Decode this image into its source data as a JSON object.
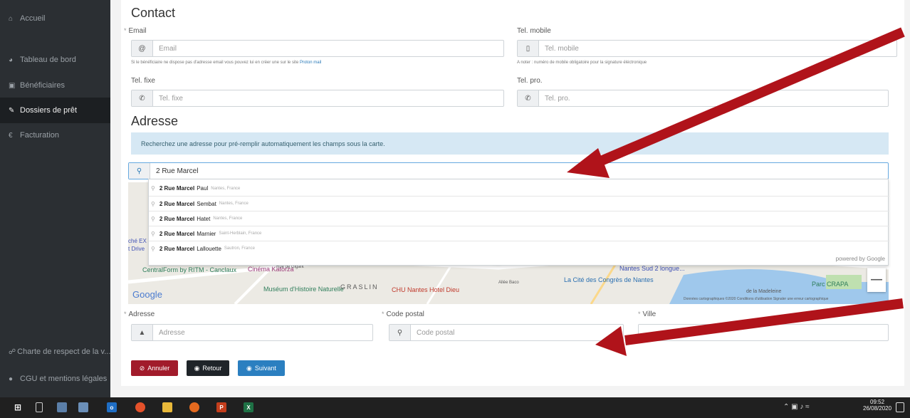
{
  "sidebar": {
    "items": [
      {
        "icon": "home-icon",
        "glyph": "⌂",
        "label": "Accueil"
      },
      {
        "icon": "dashboard-icon",
        "glyph": "◕",
        "label": "Tableau de bord"
      },
      {
        "icon": "beneficiaries-icon",
        "glyph": "▣",
        "label": "Bénéficiaires"
      },
      {
        "icon": "loan-files-icon",
        "glyph": "✎",
        "label": "Dossiers de prêt"
      },
      {
        "icon": "euro-icon",
        "glyph": "€",
        "label": "Facturation"
      },
      {
        "icon": "charter-icon",
        "glyph": "☍",
        "label": "Charte de respect de la v..."
      },
      {
        "icon": "info-icon",
        "glyph": "●",
        "label": "CGU et mentions légales"
      }
    ]
  },
  "contact": {
    "title": "Contact",
    "email": {
      "label": "Email",
      "placeholder": "Email",
      "icon_glyph": "@",
      "help": "Si le bénéficiaire ne dispose pas d'adresse email vous pouvez lui en créer une sur le site",
      "help_link": "Proton mail"
    },
    "mobile": {
      "label": "Tel. mobile",
      "placeholder": "Tel. mobile",
      "icon_glyph": "▯",
      "help": "A noter : numéro de mobile obligatoire pour la signature éléctronique"
    },
    "fixe": {
      "label": "Tel. fixe",
      "placeholder": "Tel. fixe",
      "icon_glyph": "✆"
    },
    "pro": {
      "label": "Tel. pro.",
      "placeholder": "Tel. pro.",
      "icon_glyph": "✆"
    }
  },
  "address": {
    "title": "Adresse",
    "banner": "Recherchez une adresse pour pré-remplir automatiquement les champs sous la carte.",
    "search_value": "2 Rue Marcel",
    "suggestions": [
      {
        "bold": "2 Rue Marcel",
        "rest": "Paul",
        "loc": "Nantes, France"
      },
      {
        "bold": "2 Rue Marcel",
        "rest": "Sembat",
        "loc": "Nantes, France"
      },
      {
        "bold": "2 Rue Marcel",
        "rest": "Hatet",
        "loc": "Nantes, France"
      },
      {
        "bold": "2 Rue Marcel",
        "rest": "Marnier",
        "loc": "Saint-Herblain, France"
      },
      {
        "bold": "2 Rue Marcel",
        "rest": "Lallouette",
        "loc": "Sautron, France"
      }
    ],
    "powered": "powered by Google",
    "adresse": {
      "label": "Adresse",
      "placeholder": "Adresse"
    },
    "code_postal": {
      "label": "Code postal",
      "placeholder": "Code postal"
    },
    "ville": {
      "label": "Ville"
    }
  },
  "map": {
    "labels": [
      "CentralForm by RITM - Canclaux",
      "Cinéma Katorza",
      "Muséum d'Histoire Naturelle",
      "GRASLIN",
      "CHU Nantes Hotel Dieu",
      "La Cité des Congrès de Nantes",
      "Nantes Sud 2 longue...",
      "Parc CRAPA",
      "Google",
      "Rue de Gigant",
      "Allée Baco",
      "de la Madeleine",
      "ché EX",
      "t Drive"
    ],
    "footer": "Données cartographiques ©2020   Conditions d'utilisation   Signaler une erreur cartographique"
  },
  "buttons": {
    "cancel": "Annuler",
    "back": "Retour",
    "next": "Suivant"
  },
  "colors": {
    "cancel": "#a11b2b",
    "back": "#1f2429",
    "next": "#2b7fc0",
    "arrow": "#b0131a"
  },
  "taskbar": {
    "time": "09:52",
    "date": "26/08/2020"
  }
}
